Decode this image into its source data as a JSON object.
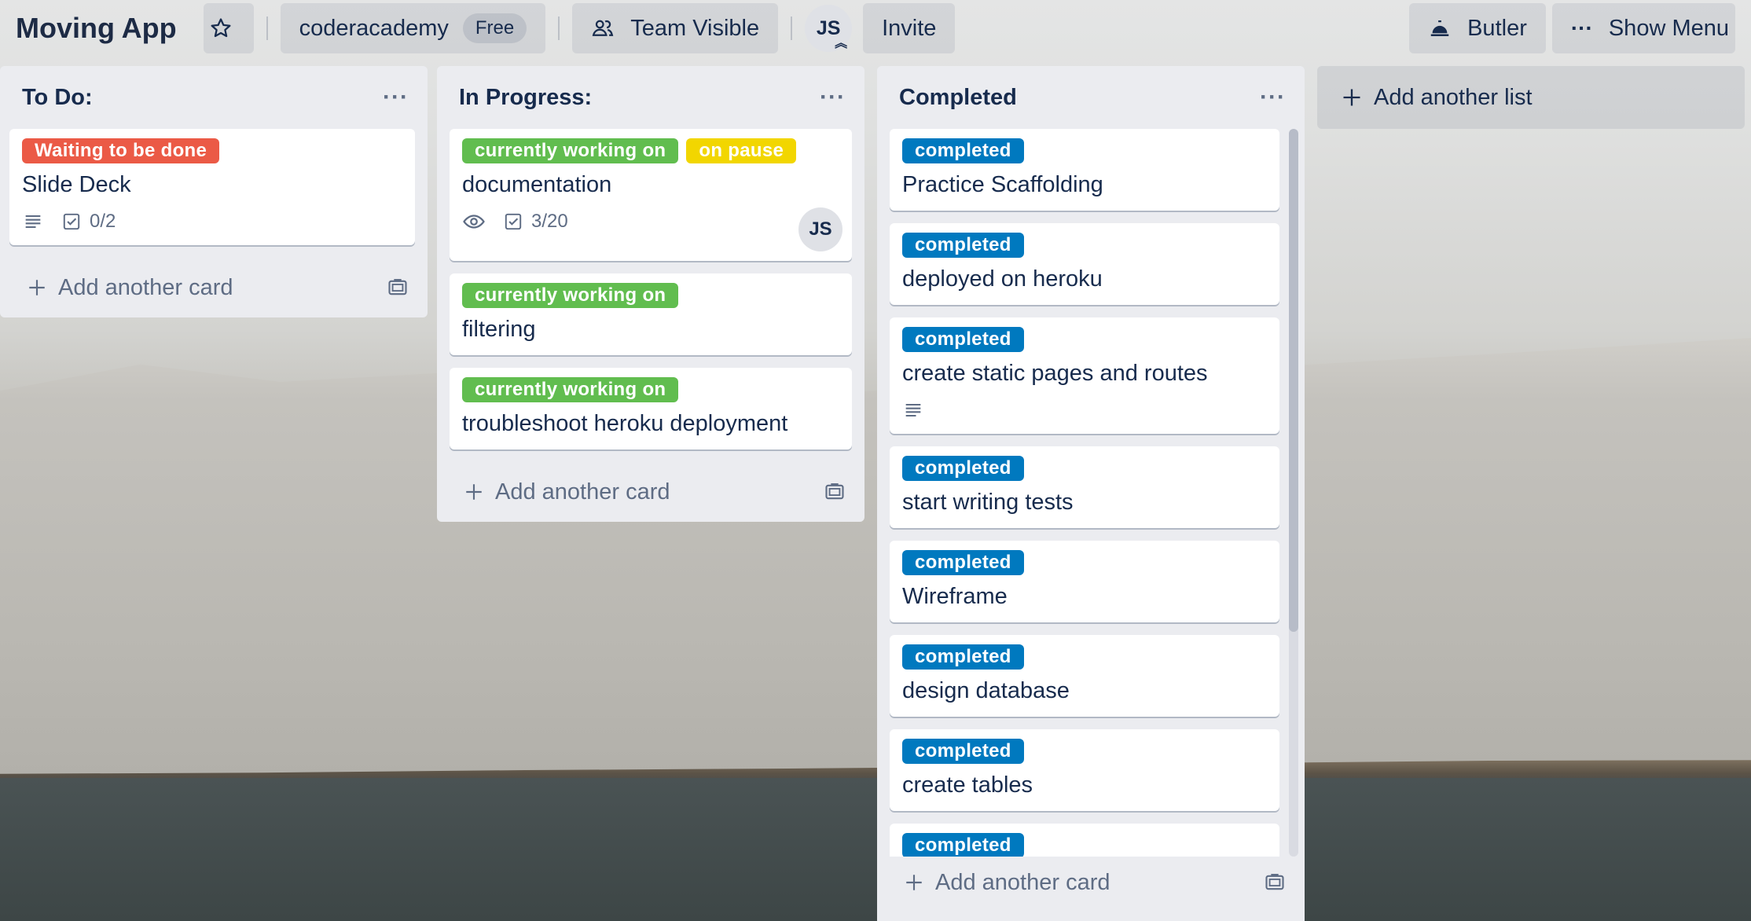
{
  "header": {
    "board_title": "Moving App",
    "workspace": "coderacademy",
    "workspace_plan": "Free",
    "visibility": "Team Visible",
    "member_initials": "JS",
    "invite_label": "Invite",
    "butler_label": "Butler",
    "show_menu_label": "Show Menu"
  },
  "colors": {
    "label_red": "#eb5a46",
    "label_green": "#61bd4f",
    "label_yellow": "#f2d600",
    "label_blue": "#0079bf"
  },
  "lists": [
    {
      "title": "To Do:",
      "menu": "···",
      "add_card": "Add another card",
      "cards": [
        {
          "labels": [
            {
              "text": "Waiting to be done",
              "color": "#eb5a46"
            }
          ],
          "title": "Slide Deck",
          "checklist": "0/2"
        }
      ]
    },
    {
      "title": "In Progress:",
      "menu": "···",
      "add_card": "Add another card",
      "cards": [
        {
          "labels": [
            {
              "text": "currently working on",
              "color": "#61bd4f"
            },
            {
              "text": "on pause",
              "color": "#f2d600"
            }
          ],
          "title": "documentation",
          "checklist": "3/20",
          "member": "JS"
        },
        {
          "labels": [
            {
              "text": "currently working on",
              "color": "#61bd4f"
            }
          ],
          "title": "filtering"
        },
        {
          "labels": [
            {
              "text": "currently working on",
              "color": "#61bd4f"
            }
          ],
          "title": "troubleshoot heroku deployment"
        }
      ]
    },
    {
      "title": "Completed",
      "menu": "···",
      "add_card": "Add another card",
      "cards": [
        {
          "labels": [
            {
              "text": "completed",
              "color": "#0079bf"
            }
          ],
          "title": "Practice Scaffolding"
        },
        {
          "labels": [
            {
              "text": "completed",
              "color": "#0079bf"
            }
          ],
          "title": "deployed on heroku"
        },
        {
          "labels": [
            {
              "text": "completed",
              "color": "#0079bf"
            }
          ],
          "title": "create static pages and routes"
        },
        {
          "labels": [
            {
              "text": "completed",
              "color": "#0079bf"
            }
          ],
          "title": "start writing tests"
        },
        {
          "labels": [
            {
              "text": "completed",
              "color": "#0079bf"
            }
          ],
          "title": "Wireframe"
        },
        {
          "labels": [
            {
              "text": "completed",
              "color": "#0079bf"
            }
          ],
          "title": "design database"
        },
        {
          "labels": [
            {
              "text": "completed",
              "color": "#0079bf"
            }
          ],
          "title": "create tables"
        },
        {
          "labels": [
            {
              "text": "completed",
              "color": "#0079bf"
            }
          ],
          "title": ""
        }
      ]
    }
  ],
  "add_list_label": "Add another list"
}
